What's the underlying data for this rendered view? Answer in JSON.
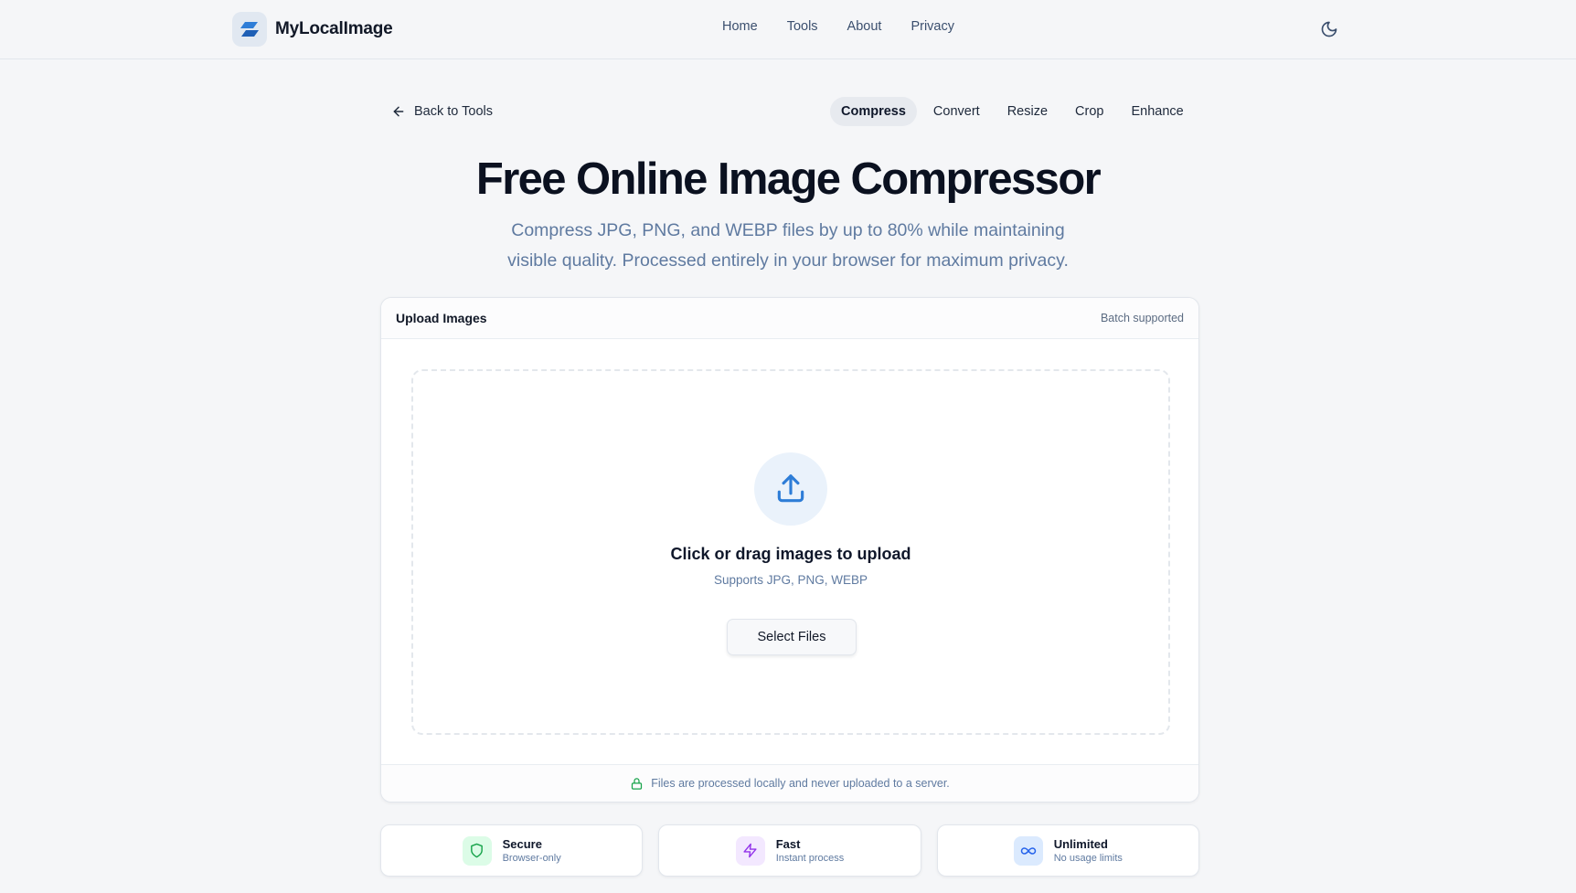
{
  "header": {
    "brand": "MyLocalImage",
    "nav": [
      "Home",
      "Tools",
      "About",
      "Privacy"
    ]
  },
  "subnav": {
    "back_label": "Back to Tools",
    "tabs": [
      {
        "label": "Compress",
        "active": true
      },
      {
        "label": "Convert",
        "active": false
      },
      {
        "label": "Resize",
        "active": false
      },
      {
        "label": "Crop",
        "active": false
      },
      {
        "label": "Enhance",
        "active": false
      }
    ]
  },
  "hero": {
    "title": "Free Online Image Compressor",
    "subtitle": "Compress JPG, PNG, and WEBP files by up to 80% while maintaining visible quality. Processed entirely in your browser for maximum privacy."
  },
  "upload": {
    "title": "Upload Images",
    "badge": "Batch supported",
    "drop_title": "Click or drag images to upload",
    "drop_sub": "Supports JPG, PNG, WEBP",
    "button": "Select Files",
    "footer": "Files are processed locally and never uploaded to a server."
  },
  "features": [
    {
      "title": "Secure",
      "sub": "Browser-only",
      "icon": "shield-icon",
      "bg": "#dcfce7",
      "fg": "#16a34a"
    },
    {
      "title": "Fast",
      "sub": "Instant process",
      "icon": "lightning-icon",
      "bg": "#f3e8ff",
      "fg": "#9333ea"
    },
    {
      "title": "Unlimited",
      "sub": "No usage limits",
      "icon": "infinity-icon",
      "bg": "#dbeafe",
      "fg": "#2563eb"
    }
  ],
  "colors": {
    "accent": "#2e7dd7",
    "background": "#f5f6f8",
    "muted_text": "#5f7aa0",
    "lock_green": "#16a34a"
  }
}
